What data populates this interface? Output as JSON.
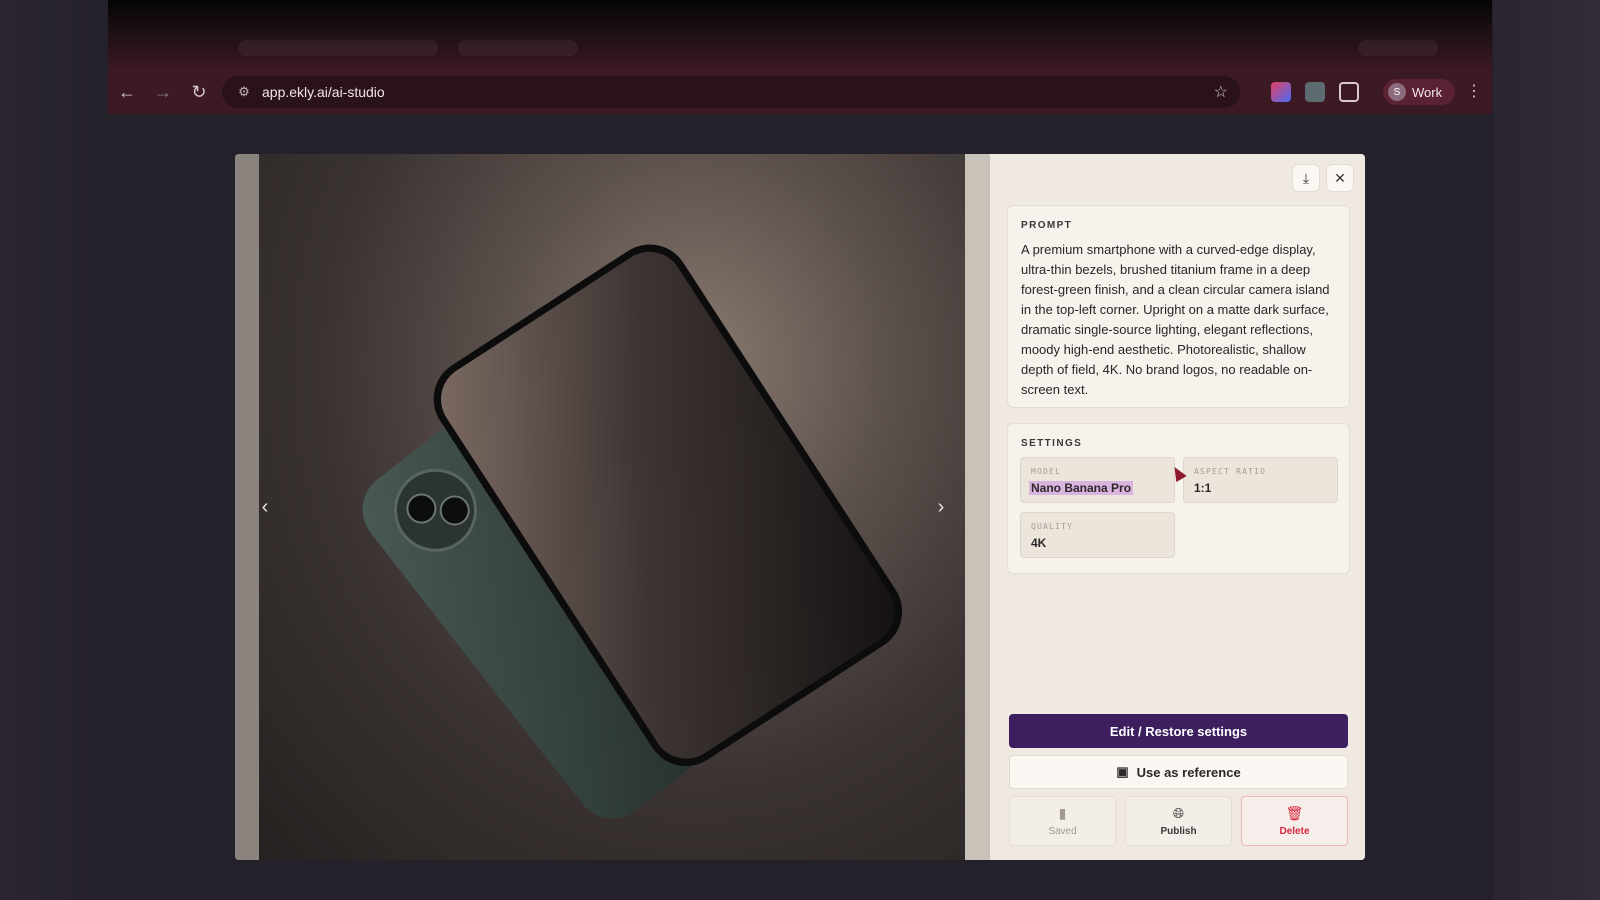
{
  "browser": {
    "url": "app.ekly.ai/ai-studio",
    "profile_initial": "S",
    "profile_label": "Work"
  },
  "viewer": {
    "prev_icon": "chevron-left-icon",
    "next_icon": "chevron-right-icon"
  },
  "panel": {
    "prompt_heading": "PROMPT",
    "prompt_text": "A premium smartphone with a curved-edge display, ultra-thin bezels, brushed titanium frame in a deep forest-green finish, and a clean circular camera island in the top-left corner. Upright on a matte dark surface, dramatic single-source lighting, elegant reflections, moody high-end aesthetic. Photorealistic, shallow depth of field, 4K. No brand logos, no readable on-screen text.",
    "settings_heading": "SETTINGS",
    "model_label": "MODEL",
    "model_value": "Nano Banana Pro",
    "aspect_label": "ASPECT RATIO",
    "aspect_value": "1:1",
    "quality_label": "QUALITY",
    "quality_value": "4K",
    "edit_button": "Edit / Restore settings",
    "reference_button": "Use as reference",
    "saved_label": "Saved",
    "publish_label": "Publish",
    "delete_label": "Delete"
  },
  "colors": {
    "primary": "#3d1f5f",
    "delete": "#d7263d",
    "toolbar": "#3b1a24"
  }
}
